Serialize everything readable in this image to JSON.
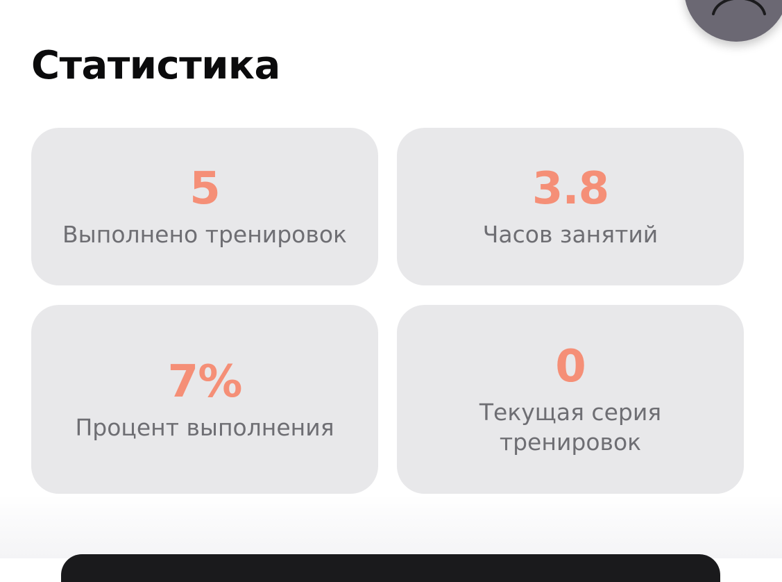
{
  "page": {
    "title": "Статистика"
  },
  "stats": [
    {
      "value": "5",
      "label": "Выполнено тренировок"
    },
    {
      "value": "3.8",
      "label": "Часов занятий"
    },
    {
      "value": "7%",
      "label": "Процент выполнения"
    },
    {
      "value": "0",
      "label": "Текущая серия тренировок"
    }
  ],
  "icons": {
    "top_right": "avatar-icon"
  },
  "colors": {
    "accent": "#f58f77",
    "card_bg": "#e8e8ea",
    "label_text": "#6e6e73",
    "title_text": "#0b0b0c",
    "fab_bg": "#6b6873"
  }
}
